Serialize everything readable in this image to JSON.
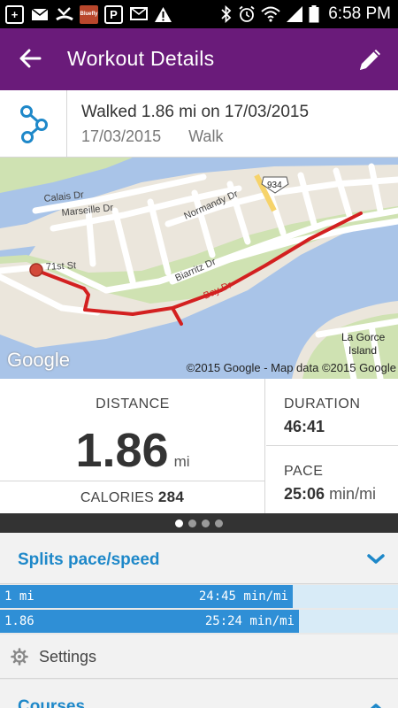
{
  "status_bar": {
    "time": "6:58 PM",
    "notification_icons": [
      "plus-icon",
      "mail-icon",
      "missed-call-icon",
      "app-icon",
      "parking-icon",
      "sms-icon",
      "warning-icon"
    ],
    "app_badge_text": "Bluefly",
    "system_icons": [
      "bluetooth-icon",
      "alarm-icon",
      "wifi-icon",
      "signal-icon",
      "battery-icon"
    ]
  },
  "app_bar": {
    "title": "Workout Details",
    "background": "#6a1b7a"
  },
  "workout": {
    "title": "Walked 1.86 mi on 17/03/2015",
    "date": "17/03/2015",
    "activity": "Walk"
  },
  "map": {
    "street_labels": [
      "Calais Dr",
      "Marseille Dr",
      "Normandy Dr",
      "71st St",
      "Biarritz Dr",
      "Bay Dr",
      "La Gorce",
      "Island"
    ],
    "route_number": "934",
    "logo": "Google",
    "attribution": "©2015 Google - Map data ©2015 Google",
    "route_color": "#d32020"
  },
  "stats": {
    "distance_label": "DISTANCE",
    "distance_value": "1.86",
    "distance_unit": "mi",
    "calories_label": "CALORIES",
    "calories_value": "284",
    "duration_label": "DURATION",
    "duration_value": "46:41",
    "pace_label": "PACE",
    "pace_value": "25:06",
    "pace_unit": "min/mi"
  },
  "pager": {
    "count": 4,
    "active": 0
  },
  "splits": {
    "title": "Splits pace/speed",
    "rows": [
      {
        "label": "1 mi",
        "pace": "24:45 min/mi",
        "fill_fraction": 0.735
      },
      {
        "label": "1.86",
        "pace": "25:24 min/mi",
        "fill_fraction": 0.75
      }
    ],
    "accent_color": "#1e88c9"
  },
  "settings": {
    "label": "Settings"
  },
  "courses": {
    "title": "Courses"
  }
}
